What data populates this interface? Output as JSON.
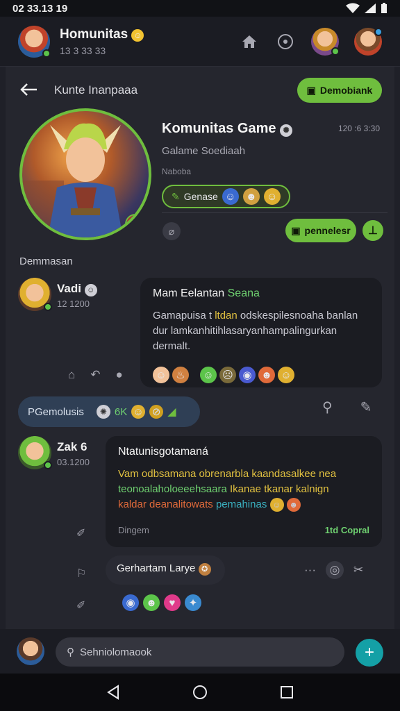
{
  "status": {
    "time": "02 33.13 19",
    "icons": [
      "wifi-icon",
      "signal-icon",
      "battery-icon"
    ]
  },
  "topbar": {
    "title": "Homunitas",
    "subtitle": "13 3 33 33"
  },
  "subheader": {
    "title": "Kunte Inanpaaa",
    "button_label": "Demobiank"
  },
  "profile": {
    "name": "Komunitas Game",
    "time": "120 :6 3:30",
    "subtitle": "Galame Soediaah",
    "small": "Naboba",
    "tag_label": "Genase",
    "button_label": "pennelesr"
  },
  "section_label": "Demmasan",
  "message1": {
    "name": "Vadi",
    "time": "12 1200",
    "title_prefix": "Mam Eelantan",
    "title_highlight": "Seana",
    "text_a": "Gamapuisa t",
    "text_b": "ltdan",
    "text_c": "odskespilesnoaha banlan dur lamkanhitihlasaryanhampalingurkan dermalt."
  },
  "reply_bar": {
    "label": "PGemolusis",
    "count": "6K"
  },
  "message2": {
    "name": "Zak 6",
    "time": "03.1200",
    "title": "Ntatunisgotamaná",
    "line1": "Vam odbsamana obrenarbla kaandasalkee nea",
    "line2a": "teonoalaholoeeehsaara",
    "line2b": "Ikanae tkanar kalnign",
    "line3a": "kaldar deanalitowats",
    "line3b": "pemahinas",
    "footer_left": "Dingem",
    "footer_right": "1td Copral"
  },
  "message3": {
    "title": "Gerhartam Larye"
  },
  "input": {
    "placeholder": "Sehniolomaook"
  },
  "colors": {
    "accent_green": "#6fbe3e",
    "teal": "#14a0a6",
    "bg": "#25262e",
    "bubble": "#1b1c22"
  }
}
